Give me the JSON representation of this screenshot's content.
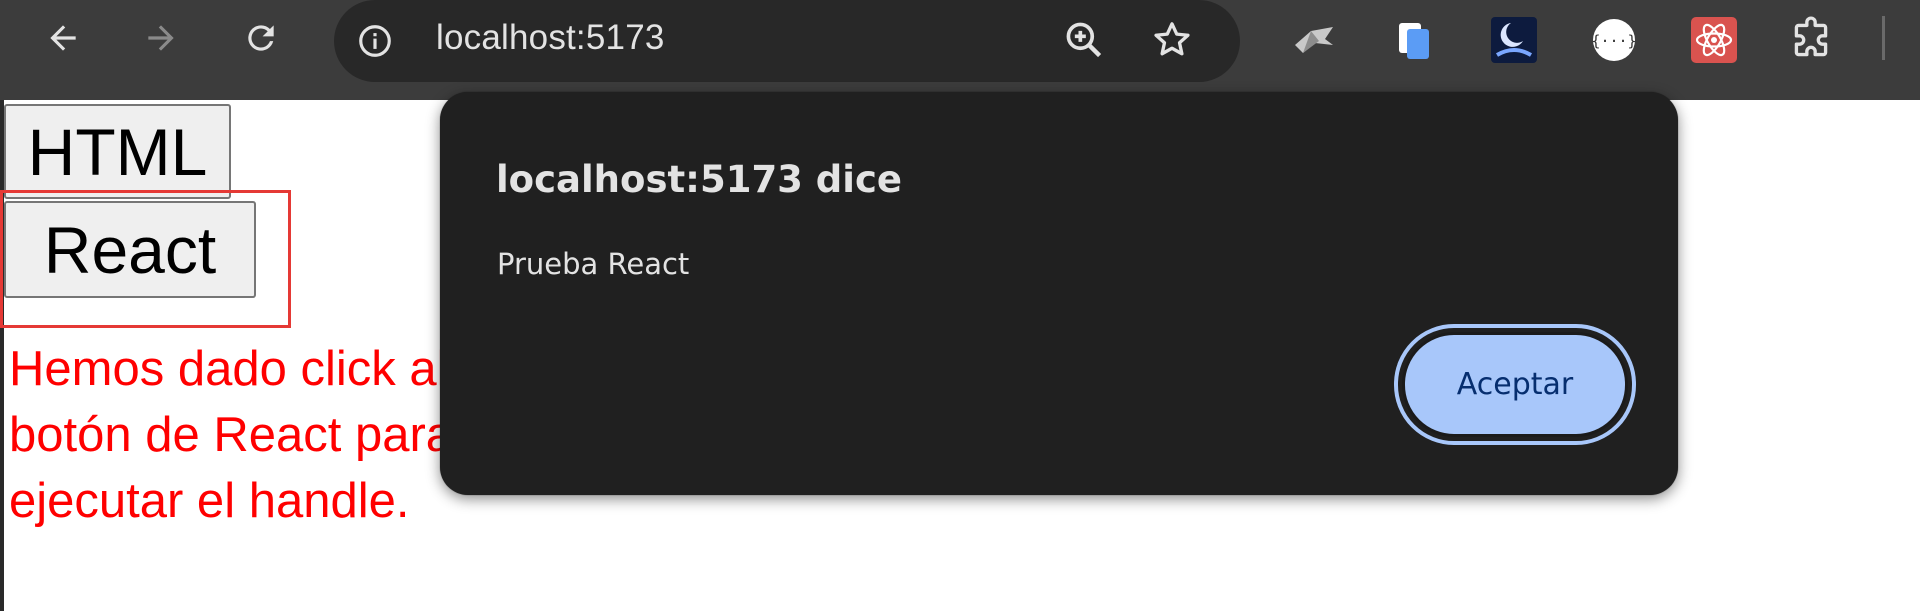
{
  "browser": {
    "url": "localhost:5173",
    "nav_icons": [
      "back-arrow-icon",
      "forward-arrow-icon",
      "reload-icon"
    ],
    "omnibox_icons": [
      "info-icon",
      "zoom-icon",
      "star-icon"
    ],
    "extension_icons": [
      "extension-bird-icon",
      "extension-copy-icon",
      "extension-moon-icon",
      "extension-json-icon",
      "extension-react-devtools-icon",
      "extensions-puzzle-icon"
    ],
    "colors": {
      "toolbar": "#3c3c3c",
      "omnibox": "#282828",
      "url_text": "#e3e3e3"
    }
  },
  "page": {
    "html_button": "HTML",
    "react_button": "React",
    "annotation": "Hemos dado click al botón de React para ejecutar el handle.",
    "annotation_color": "#ff0000"
  },
  "dialog": {
    "title": "localhost:5173 dice",
    "message": "Prueba React",
    "accept_label": "Aceptar",
    "colors": {
      "background": "#202020",
      "button": "#a8c7fa"
    }
  }
}
